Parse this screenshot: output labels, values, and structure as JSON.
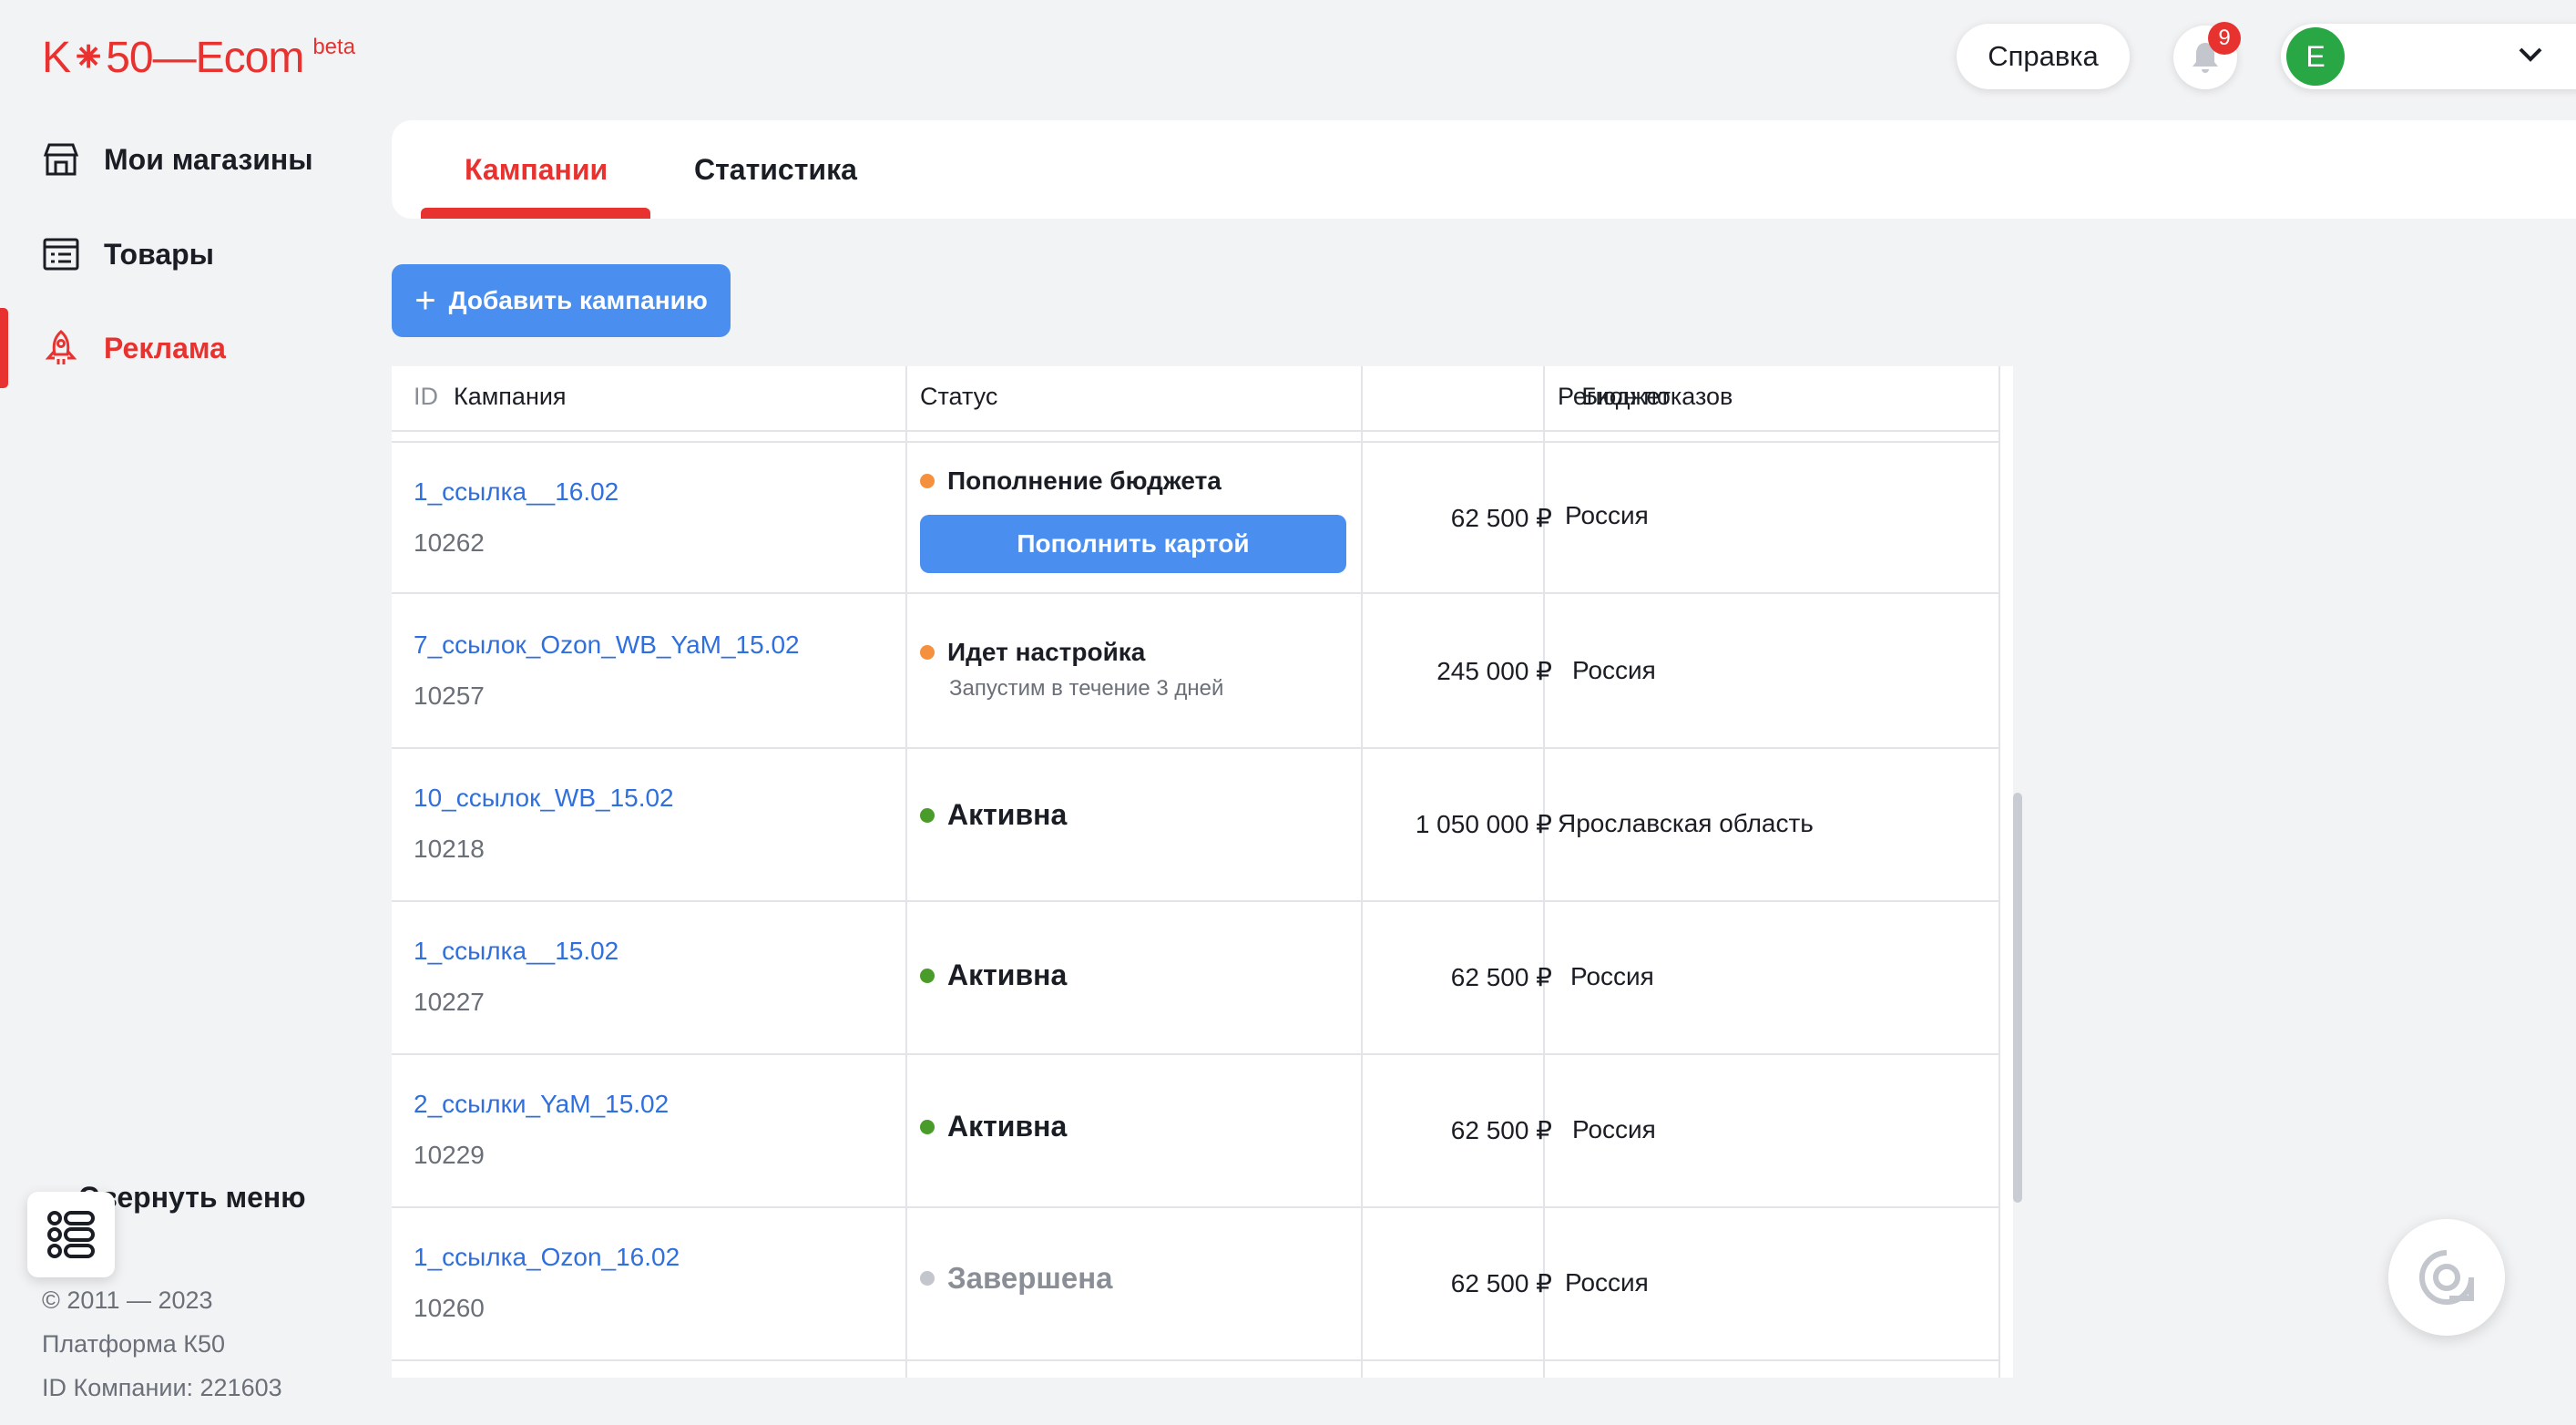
{
  "logo": {
    "text": "K⁕50—Ecom",
    "badge": "beta"
  },
  "sidebar": {
    "items": [
      {
        "label": "Мои магазины",
        "icon": "store-icon",
        "active": false
      },
      {
        "label": "Товары",
        "icon": "list-icon",
        "active": false
      },
      {
        "label": "Реклама",
        "icon": "rocket-icon",
        "active": true
      }
    ],
    "collapse_label": "Свернуть меню",
    "footer": {
      "copyright": "© 2011 — 2023",
      "platform": "Платформа К50",
      "company_id": "ID Компании: 221603"
    }
  },
  "header": {
    "help_label": "Справка",
    "notifications_count": "9",
    "user_initial": "Е"
  },
  "tabs": [
    {
      "label": "Кампании",
      "active": true
    },
    {
      "label": "Статистика",
      "active": false
    }
  ],
  "add_campaign_label": "Добавить кампанию",
  "table": {
    "headers": {
      "id": "ID",
      "campaign": "Кампания",
      "status": "Статус",
      "budget": "Бюджет",
      "region": "Регион показов"
    },
    "rows": [
      {
        "name": "1_ссылка__16.02",
        "id": "10262",
        "status": "Пополнение бюджета",
        "status_color": "#f5913e",
        "action": "Пополнить картой",
        "budget": "62 500 ₽",
        "region": "Россия"
      },
      {
        "name": "7_ссылок_Ozon_WB_YaM_15.02",
        "id": "10257",
        "status": "Идет настройка",
        "status_color": "#f5913e",
        "status_sub": "Запустим в течение 3 дней",
        "budget": "245 000 ₽",
        "region": "Россия"
      },
      {
        "name": "10_ссылок_WB_15.02",
        "id": "10218",
        "status": "Активна",
        "status_color": "#4a9c2a",
        "budget": "1 050 000 ₽",
        "region": "Ярославская область"
      },
      {
        "name": "1_ссылка__15.02",
        "id": "10227",
        "status": "Активна",
        "status_color": "#4a9c2a",
        "budget": "62 500 ₽",
        "region": "Россия"
      },
      {
        "name": "2_ссылки_YaM_15.02",
        "id": "10229",
        "status": "Активна",
        "status_color": "#4a9c2a",
        "budget": "62 500 ₽",
        "region": "Россия"
      },
      {
        "name": "1_ссылка_Ozon_16.02",
        "id": "10260",
        "status": "Завершена",
        "status_color": "#c3c6cc",
        "budget": "62 500 ₽",
        "region": "Россия"
      }
    ]
  },
  "colors": {
    "brand": "#e8322f",
    "primary_button": "#4a8ff0",
    "link": "#2f6fde",
    "background": "#f2f3f5"
  }
}
